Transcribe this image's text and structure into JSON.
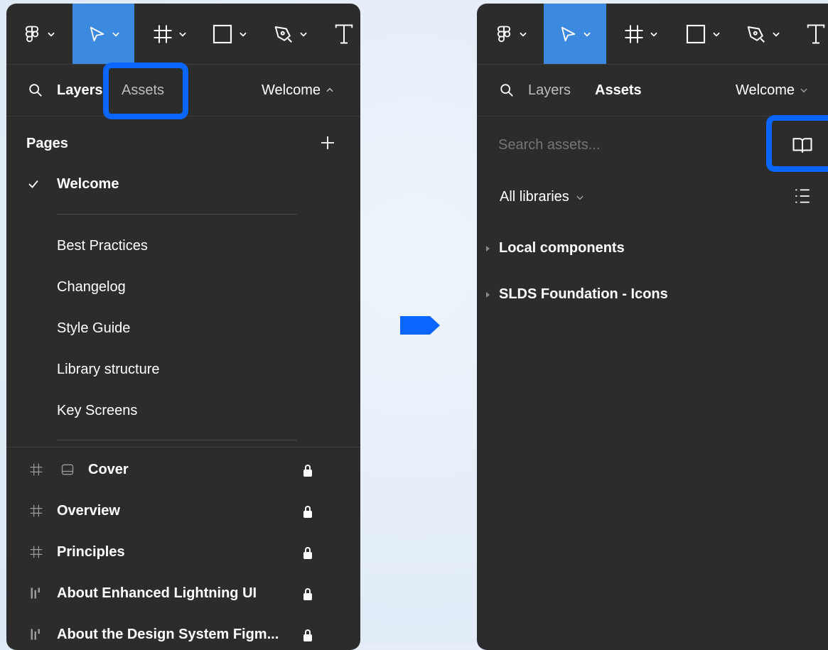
{
  "left_panel": {
    "tabs": {
      "layers": "Layers",
      "assets": "Assets",
      "page": "Welcome"
    },
    "pages_header": "Pages",
    "current_page": "Welcome",
    "pages": [
      "Best Practices",
      "Changelog",
      "Style Guide",
      "Library structure",
      "Key Screens"
    ],
    "layers": [
      {
        "name": "Cover",
        "icon": "frame-icon",
        "locked": true
      },
      {
        "name": "Overview",
        "icon": "frame-icon",
        "locked": true
      },
      {
        "name": "Principles",
        "icon": "frame-icon",
        "locked": true
      },
      {
        "name": "About Enhanced Lightning UI",
        "icon": "section-icon",
        "locked": true
      },
      {
        "name": "About the Design System Figm...",
        "icon": "section-icon",
        "locked": true
      }
    ]
  },
  "right_panel": {
    "tabs": {
      "layers": "Layers",
      "assets": "Assets",
      "page": "Welcome"
    },
    "search_placeholder": "Search assets...",
    "library_filter": "All libraries",
    "groups": [
      "Local components",
      "SLDS Foundation - Icons"
    ]
  },
  "colors": {
    "panel": "#2c2c2c",
    "active_tool": "#3b8ae0",
    "highlight": "#0a66ff"
  }
}
